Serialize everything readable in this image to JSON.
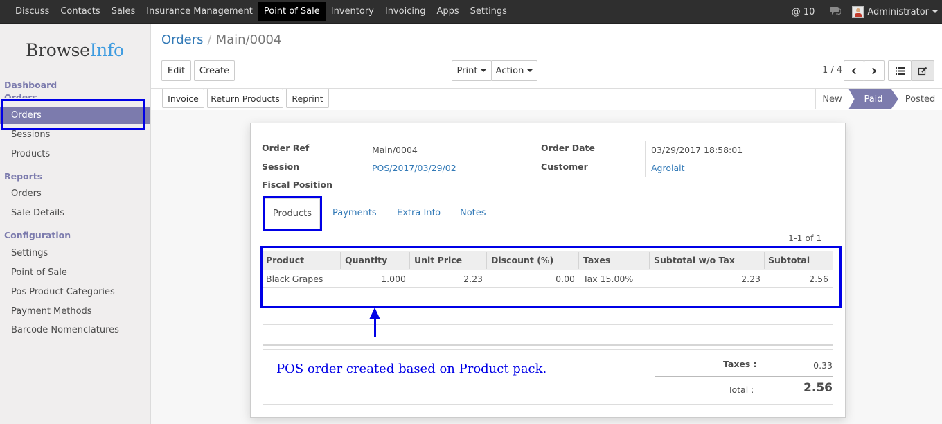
{
  "topbar": {
    "menu": [
      "Discuss",
      "Contacts",
      "Sales",
      "Insurance Management",
      "Point of Sale",
      "Inventory",
      "Invoicing",
      "Apps",
      "Settings"
    ],
    "active_index": 4,
    "notifications": "@ 10",
    "user": "Administrator"
  },
  "sidebar": {
    "logo_a": "Browse",
    "logo_b": "Info",
    "sections": {
      "dashboard": "Dashboard",
      "orders": "Orders",
      "reports": "Reports",
      "configuration": "Configuration"
    },
    "items": {
      "orders": "Orders",
      "sessions": "Sessions",
      "products": "Products",
      "report_orders": "Orders",
      "sale_details": "Sale Details",
      "settings": "Settings",
      "point_of_sale": "Point of Sale",
      "pos_categories": "Pos Product Categories",
      "payment_methods": "Payment Methods",
      "barcode": "Barcode Nomenclatures"
    }
  },
  "breadcrumb": {
    "parent": "Orders",
    "separator": "/",
    "current": "Main/0004"
  },
  "toolbar": {
    "edit": "Edit",
    "create": "Create",
    "print": "Print",
    "action": "Action",
    "pager": "1 / 4"
  },
  "header_buttons": {
    "invoice": "Invoice",
    "return_products": "Return Products",
    "reprint": "Reprint"
  },
  "status": {
    "new": "New",
    "paid": "Paid",
    "posted": "Posted",
    "current": "Paid"
  },
  "form": {
    "order_ref_label": "Order Ref",
    "order_ref": "Main/0004",
    "session_label": "Session",
    "session": "POS/2017/03/29/02",
    "fiscal_label": "Fiscal Position",
    "order_date_label": "Order Date",
    "order_date": "03/29/2017 18:58:01",
    "customer_label": "Customer",
    "customer": "Agrolait"
  },
  "tabs": [
    "Products",
    "Payments",
    "Extra Info",
    "Notes"
  ],
  "lines_pager": "1-1 of 1",
  "table": {
    "columns": [
      "Product",
      "Quantity",
      "Unit Price",
      "Discount (%)",
      "Taxes",
      "Subtotal w/o Tax",
      "Subtotal"
    ],
    "rows": [
      [
        "Black Grapes",
        "1.000",
        "2.23",
        "0.00",
        "Tax 15.00%",
        "2.23",
        "2.56"
      ]
    ]
  },
  "totals": {
    "taxes_label": "Taxes :",
    "taxes": "0.33",
    "total_label": "Total :",
    "total": "2.56"
  },
  "annotation": "POS order created based on Product pack.",
  "colors": {
    "accent": "#7c7bad",
    "link": "#337ab7",
    "highlight": "#0000e6",
    "topbar": "#2f2f2f"
  }
}
